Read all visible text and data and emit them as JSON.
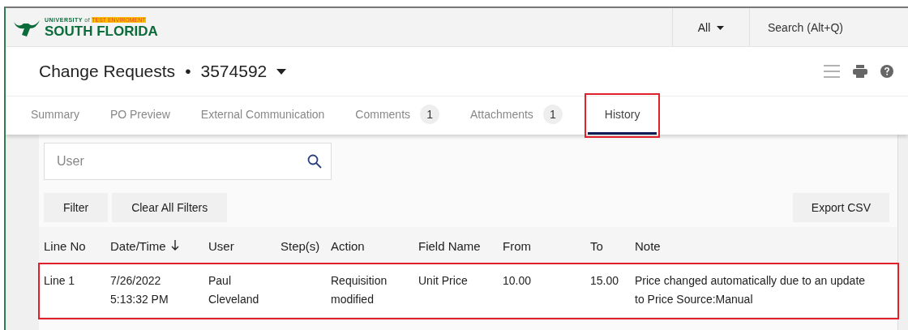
{
  "logo": {
    "top": "UNIVERSITY",
    "of": "of",
    "env": "TEST ENVIROMENT",
    "name": "SOUTH FLORIDA"
  },
  "header": {
    "scope": "All",
    "search": {
      "placeholder": "Search (Alt+Q)"
    }
  },
  "page": {
    "title": "Change Requests",
    "separator": "•",
    "number": "3574592"
  },
  "tabs": [
    {
      "label": "Summary",
      "selected": false,
      "highlighted": false
    },
    {
      "label": "PO Preview",
      "selected": false,
      "highlighted": false
    },
    {
      "label": "External Communication",
      "selected": false,
      "highlighted": false
    },
    {
      "label": "Comments",
      "count": "1",
      "selected": false,
      "highlighted": false
    },
    {
      "label": "Attachments",
      "count": "1",
      "selected": false,
      "highlighted": false
    },
    {
      "label": "History",
      "selected": true,
      "highlighted": true
    }
  ],
  "user_search": {
    "placeholder": "User"
  },
  "buttons": {
    "left": [
      "Filter",
      "Clear All Filters"
    ],
    "right": [
      "Export CSV"
    ]
  },
  "table": {
    "columns": [
      {
        "label": "Line No"
      },
      {
        "label": "Date/Time",
        "sorted": true
      },
      {
        "label": "User"
      },
      {
        "label": "Step(s)"
      },
      {
        "label": "Action"
      },
      {
        "label": "Field Name"
      },
      {
        "label": "From"
      },
      {
        "label": "To"
      },
      {
        "label": "Note"
      }
    ],
    "rows": [
      {
        "highlighted": true,
        "cells": [
          "Line 1",
          "7/26/2022\n5:13:32 PM",
          "Paul\nCleveland",
          "",
          "Requisition\nmodified",
          "Unit Price",
          "10.00",
          "15.00",
          "Price changed automatically due to an update\nto Price Source:Manual"
        ]
      }
    ]
  }
}
